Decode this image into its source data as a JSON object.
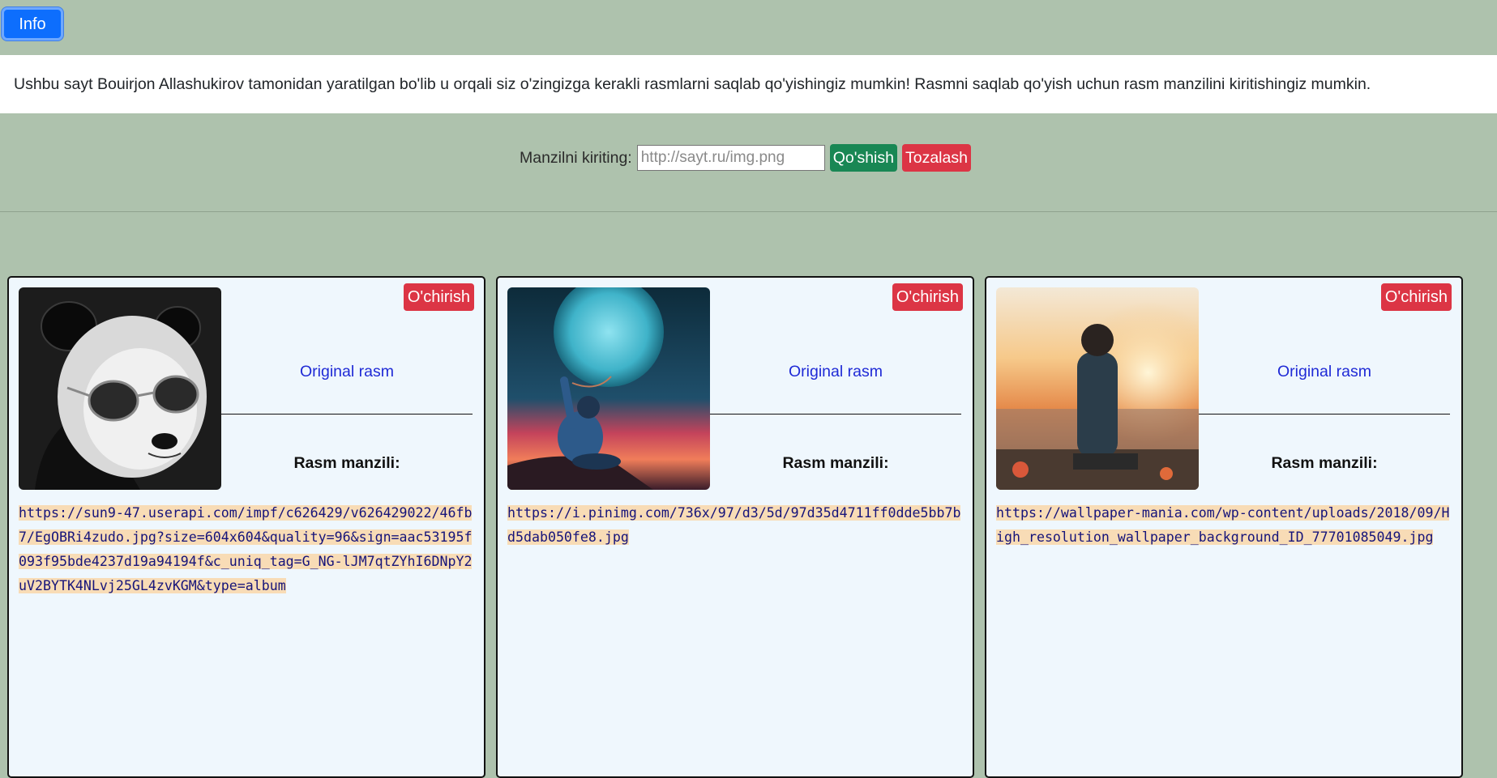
{
  "info_button": "Info",
  "info_text": "Ushbu sayt Bouirjon Allashukirov tamonidan yaratilgan bo'lib u orqali siz o'zingizga kerakli rasmlarni saqlab qo'yishingiz mumkin! Rasmni saqlab qo'yish uchun rasm manzilini kiritishingiz mumkin.",
  "form": {
    "label": "Manzilni kiriting:",
    "placeholder": "http://sayt.ru/img.png",
    "value": "",
    "add_label": "Qo'shish",
    "clear_label": "Tozalash"
  },
  "cards": [
    {
      "delete_label": "O'chirish",
      "original_label": "Original rasm",
      "address_label": "Rasm manzili:",
      "url": "https://sun9-47.userapi.com/impf/c626429/v626429022/46fb7/EgOBRi4zudo.jpg?size=604x604&quality=96&sign=aac53195f093f95bde4237d19a94194f&c_uniq_tag=G_NG-lJM7qtZYhI6DNpY2uV2BYTK4NLvj25GL4zvKGM&type=album",
      "image": "panda-with-sunglasses"
    },
    {
      "delete_label": "O'chirish",
      "original_label": "Original rasm",
      "address_label": "Rasm manzili:",
      "url": "https://i.pinimg.com/736x/97/d3/5d/97d35d4711ff0dde5bb7bd5dab050fe8.jpg",
      "image": "person-holding-moon-balloon"
    },
    {
      "delete_label": "O'chirish",
      "original_label": "Original rasm",
      "address_label": "Rasm manzili:",
      "url": "https://wallpaper-mania.com/wp-content/uploads/2018/09/High_resolution_wallpaper_background_ID_77701085049.jpg",
      "image": "man-sitting-at-sunset"
    }
  ],
  "colors": {
    "page_bg": "#aec2ad",
    "primary": "#0d6efd",
    "success": "#198754",
    "danger": "#dc3545",
    "card_bg": "#eff7fd",
    "link": "#1f2ad6",
    "url_highlight": "#f8dcb6"
  }
}
